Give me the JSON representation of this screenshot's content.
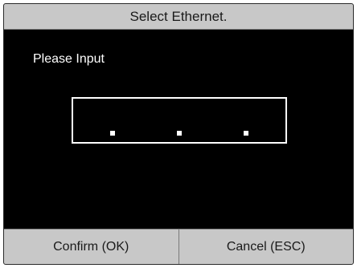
{
  "dialog": {
    "title": "Select Ethernet."
  },
  "prompt": {
    "label": "Please Input"
  },
  "ip_input": {
    "separators": [
      ".",
      ".",
      "."
    ]
  },
  "buttons": {
    "confirm_label": "Confirm (OK)",
    "cancel_label": "Cancel (ESC)"
  },
  "colors": {
    "title_bar_bg": "#c8c8c8",
    "screen_bg": "#000000",
    "text_light": "#ffffff",
    "text_dark": "#1a1a1a"
  }
}
